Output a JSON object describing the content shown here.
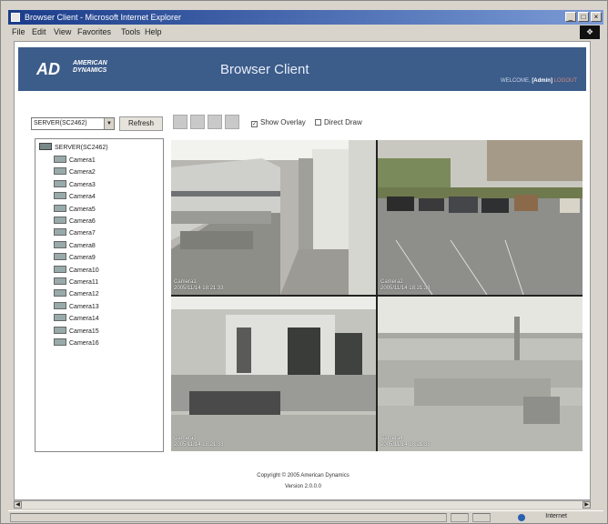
{
  "window": {
    "title": "Browser Client - Microsoft Internet Explorer",
    "controls": [
      "_",
      "□",
      "×"
    ]
  },
  "menubar": {
    "items": [
      "File",
      "Edit",
      "View",
      "Favorites",
      "Tools",
      "Help"
    ]
  },
  "banner": {
    "logo_text": "AD",
    "logo_sub_1": "AMERICAN",
    "logo_sub_2": "DYNAMICS",
    "title": "Browser Client",
    "welcome_prefix": "WELCOME,",
    "user": "[Admin]",
    "logout": "LOGOUT"
  },
  "toolbar": {
    "server_value": "SERVER(SC2462)",
    "refresh_label": "Refresh",
    "show_overlay_label": "Show Overlay",
    "show_overlay_checked": true,
    "direct_draw_label": "Direct Draw",
    "direct_draw_checked": false
  },
  "tree": {
    "root": "SERVER(SC2462)",
    "cameras": [
      "Camera1",
      "Camera2",
      "Camera3",
      "Camera4",
      "Camera5",
      "Camera6",
      "Camera7",
      "Camera8",
      "Camera9",
      "Camera10",
      "Camera11",
      "Camera12",
      "Camera13",
      "Camera14",
      "Camera15",
      "Camera16"
    ]
  },
  "tiles": [
    {
      "name": "Camera1",
      "timestamp": "2005/11/14 18:21:33"
    },
    {
      "name": "Camera2",
      "timestamp": "2005/11/14 18:21:33"
    },
    {
      "name": "Camera3",
      "timestamp": "2005/11/14 18:21:33"
    },
    {
      "name": "Camera4",
      "timestamp": "2005/11/14 18:21:33"
    }
  ],
  "footer": {
    "copyright": "Copyright © 2005 American Dynamics",
    "version": "Version 2.0.0.0"
  },
  "statusbar": {
    "zone": "Internet"
  },
  "colors": {
    "banner": "#3c5c8a",
    "titlebar": "#1a3c8a"
  }
}
